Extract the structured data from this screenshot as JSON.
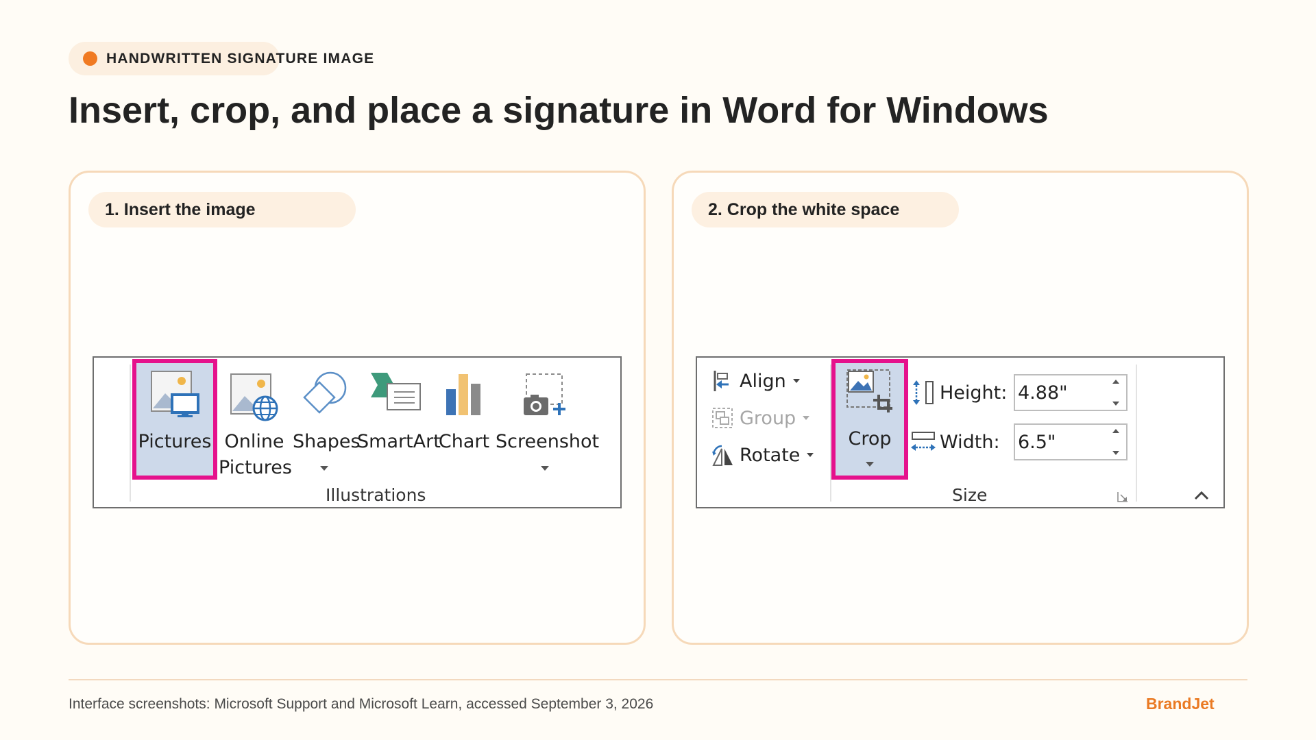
{
  "eyebrow": {
    "label": "HANDWRITTEN SIGNATURE IMAGE"
  },
  "page": {
    "title": "Insert, crop, and place a signature in Word for Windows"
  },
  "step1": {
    "title": "1. Insert the image",
    "ribbon": {
      "buttons": {
        "pictures": "Pictures",
        "online_pictures_line1": "Online",
        "online_pictures_line2": "Pictures",
        "shapes": "Shapes",
        "smartart": "SmartArt",
        "chart": "Chart",
        "screenshot": "Screenshot"
      },
      "group_label": "Illustrations"
    }
  },
  "step2": {
    "title": "2. Crop the white space",
    "ribbon": {
      "align": "Align",
      "group": "Group",
      "rotate": "Rotate",
      "crop": "Crop",
      "height_label": "Height:",
      "height_value": "4.88\"",
      "width_label": "Width:",
      "width_value": "6.5\"",
      "group_label": "Size"
    }
  },
  "footer": {
    "source": "Interface screenshots: Microsoft Support and Microsoft Learn, accessed September 3, 2026",
    "brand": "BrandJet"
  },
  "colors": {
    "accent": "#f07a22",
    "highlight": "#e5128c",
    "selected_fill": "#cdd9ea",
    "card_border": "#f6d9b9"
  }
}
